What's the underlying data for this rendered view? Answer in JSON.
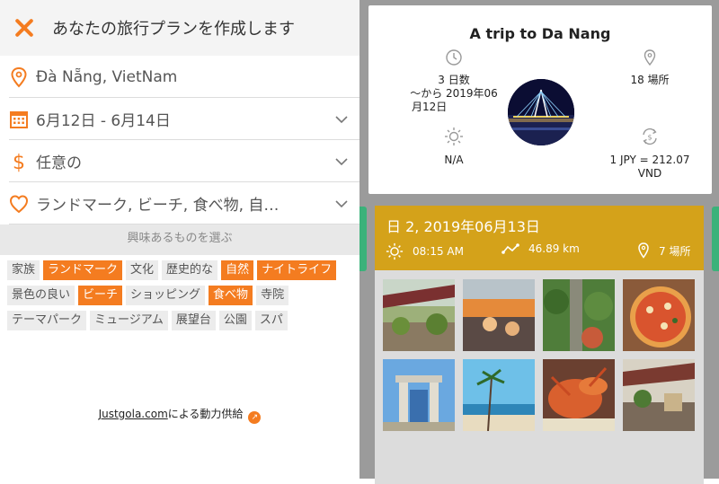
{
  "header": {
    "title": "あなたの旅行プランを作成します"
  },
  "form": {
    "destination": "Đà Nẵng, VietNam",
    "dates": "6月12日 - 6月14日",
    "budget": "任意の",
    "interests": "ランドマーク, ビーチ, 食べ物, 自…"
  },
  "interest_label": "興味あるものを選ぶ",
  "tags": [
    {
      "label": "家族",
      "selected": false
    },
    {
      "label": "ランドマーク",
      "selected": true
    },
    {
      "label": "文化",
      "selected": false
    },
    {
      "label": "歴史的な",
      "selected": false
    },
    {
      "label": "自然",
      "selected": true
    },
    {
      "label": "ナイトライフ",
      "selected": true
    },
    {
      "label": "景色の良い",
      "selected": false
    },
    {
      "label": "ビーチ",
      "selected": true
    },
    {
      "label": "ショッピング",
      "selected": false
    },
    {
      "label": "食べ物",
      "selected": true
    },
    {
      "label": "寺院",
      "selected": false
    },
    {
      "label": "テーマパーク",
      "selected": false
    },
    {
      "label": "ミュージアム",
      "selected": false
    },
    {
      "label": "展望台",
      "selected": false
    },
    {
      "label": "公園",
      "selected": false
    },
    {
      "label": "スパ",
      "selected": false
    }
  ],
  "powered": {
    "brand": "Justgola.com",
    "suffix": "による動力供給"
  },
  "trip": {
    "title": "A trip to Da Nang",
    "duration_line1": "3 日数",
    "duration_line2": "〜から 2019年06",
    "duration_line3": "月12日",
    "places": "18 場所",
    "weather": "N/A",
    "currency_line1": "1 JPY = 212.07",
    "currency_line2": "VND"
  },
  "day": {
    "title": "日 2, 2019年06月13日",
    "time": "08:15 AM",
    "distance": "46.89 km",
    "places": "7 場所"
  },
  "colors": {
    "accent": "#f47c20",
    "day_header": "#d4a21a",
    "green": "#3bb27a"
  }
}
